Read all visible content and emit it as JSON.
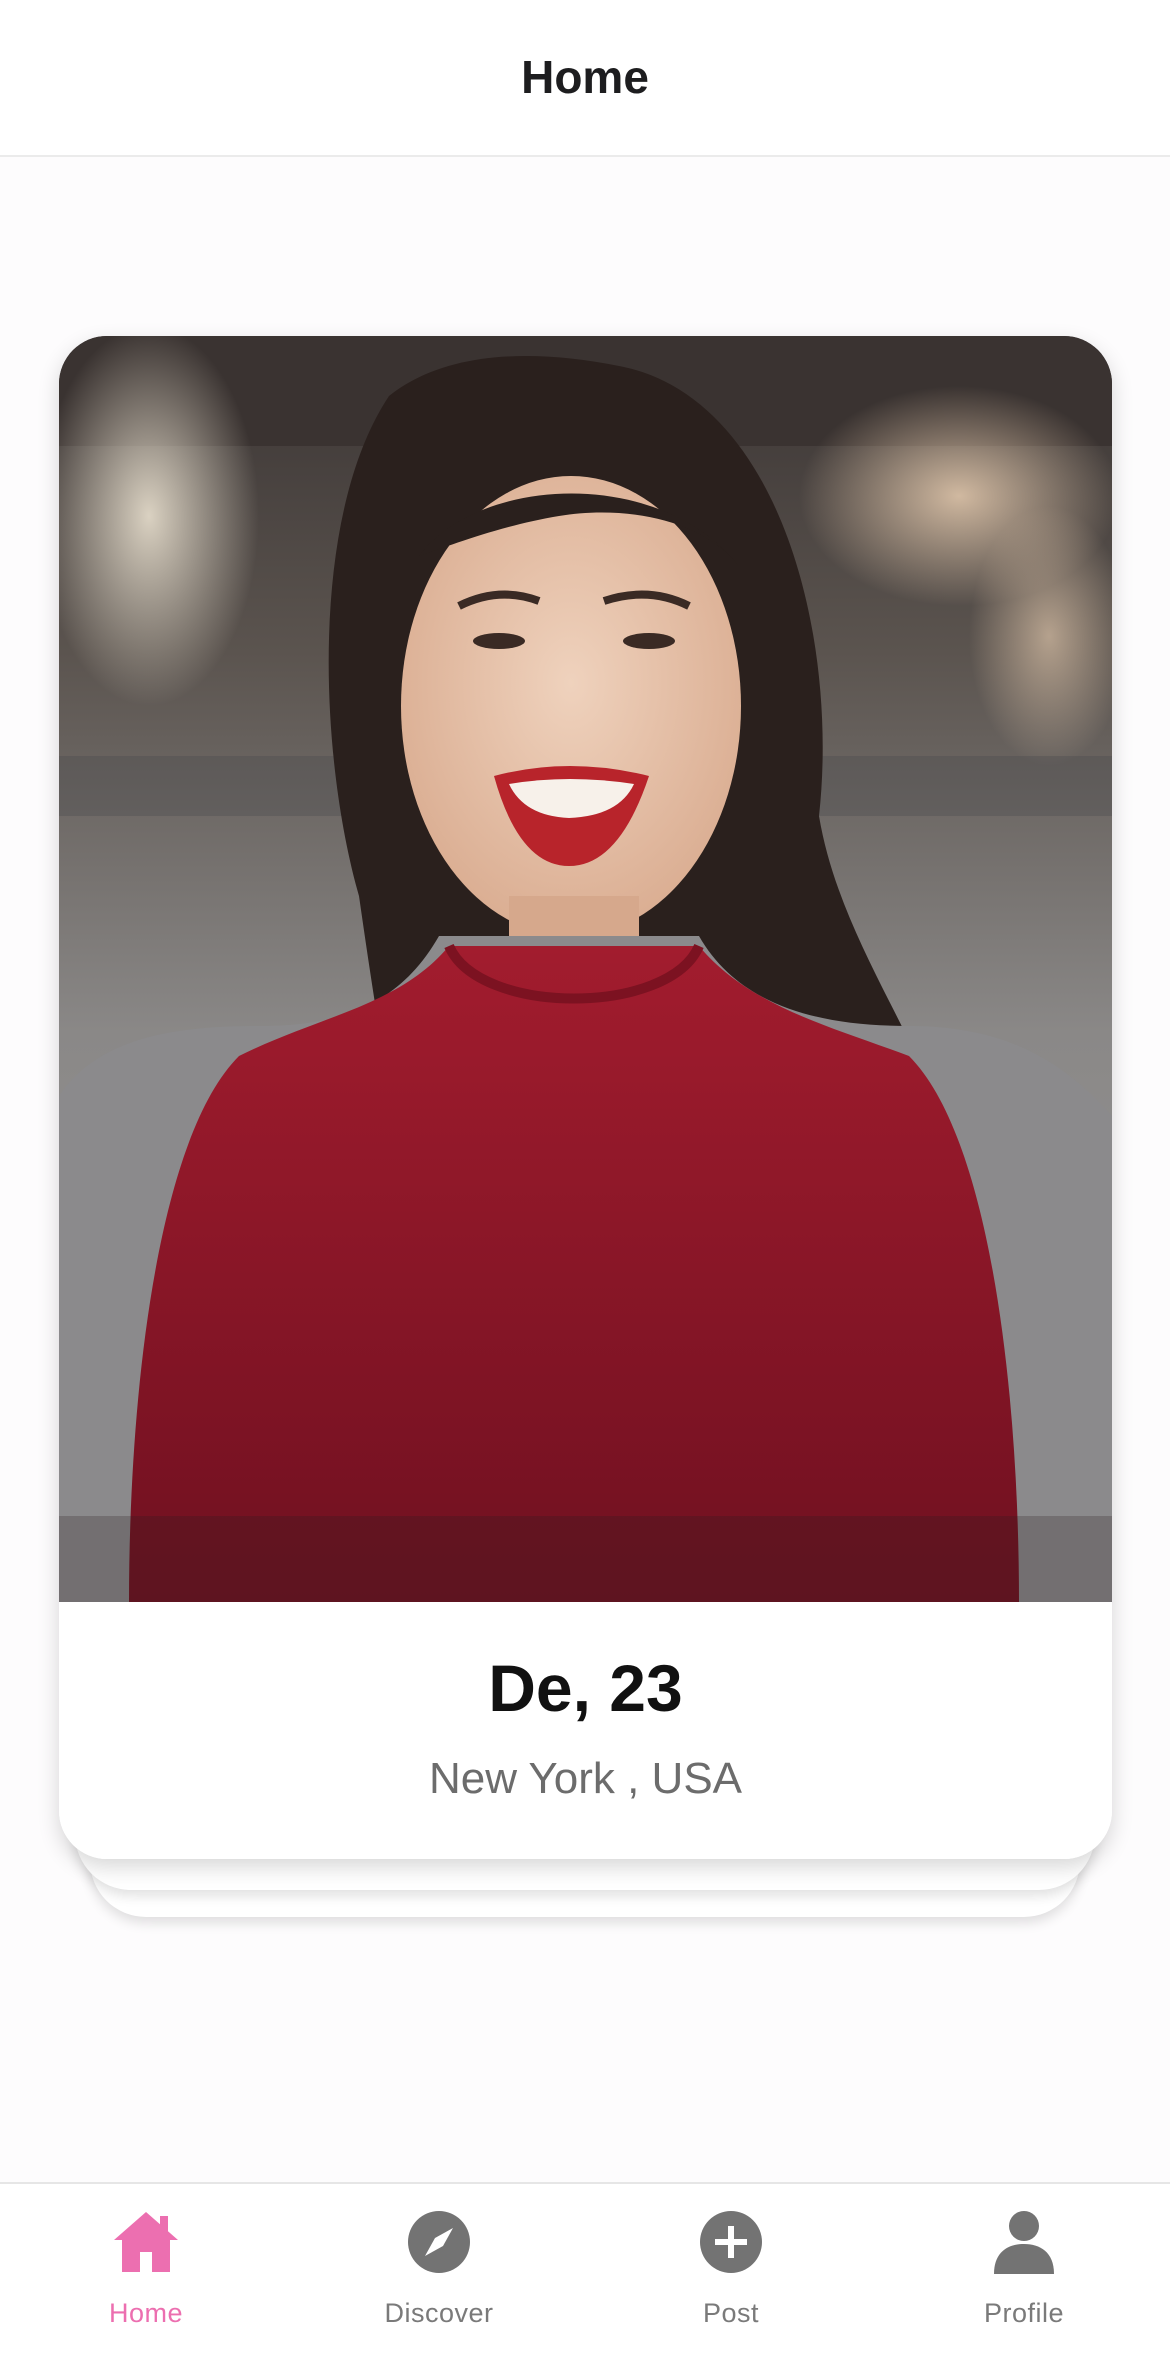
{
  "header": {
    "title": "Home"
  },
  "card": {
    "name_age": "De, 23",
    "location": "New York , USA"
  },
  "tabbar": {
    "active_color": "#ec6fb0",
    "inactive_color": "#7a7a7a",
    "items": [
      {
        "label": "Home",
        "icon": "home-icon",
        "active": true
      },
      {
        "label": "Discover",
        "icon": "compass-icon",
        "active": false
      },
      {
        "label": "Post",
        "icon": "plus-circle-icon",
        "active": false
      },
      {
        "label": "Profile",
        "icon": "person-icon",
        "active": false
      }
    ]
  }
}
